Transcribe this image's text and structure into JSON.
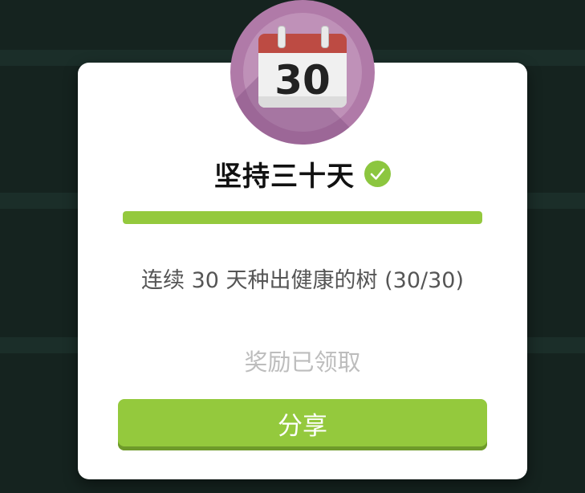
{
  "badge": {
    "icon": "calendar-icon",
    "day_number": "30",
    "circle_color": "#b07aa8"
  },
  "achievement": {
    "title": "坚持三十天",
    "completed_icon": "check-circle-icon",
    "progress": 1.0,
    "progress_color": "#94c93d",
    "description": "连续 30 天种出健康的树 (30/30)",
    "reward_status": "奖励已领取"
  },
  "actions": {
    "share_label": "分享",
    "share_color": "#94c93d"
  }
}
